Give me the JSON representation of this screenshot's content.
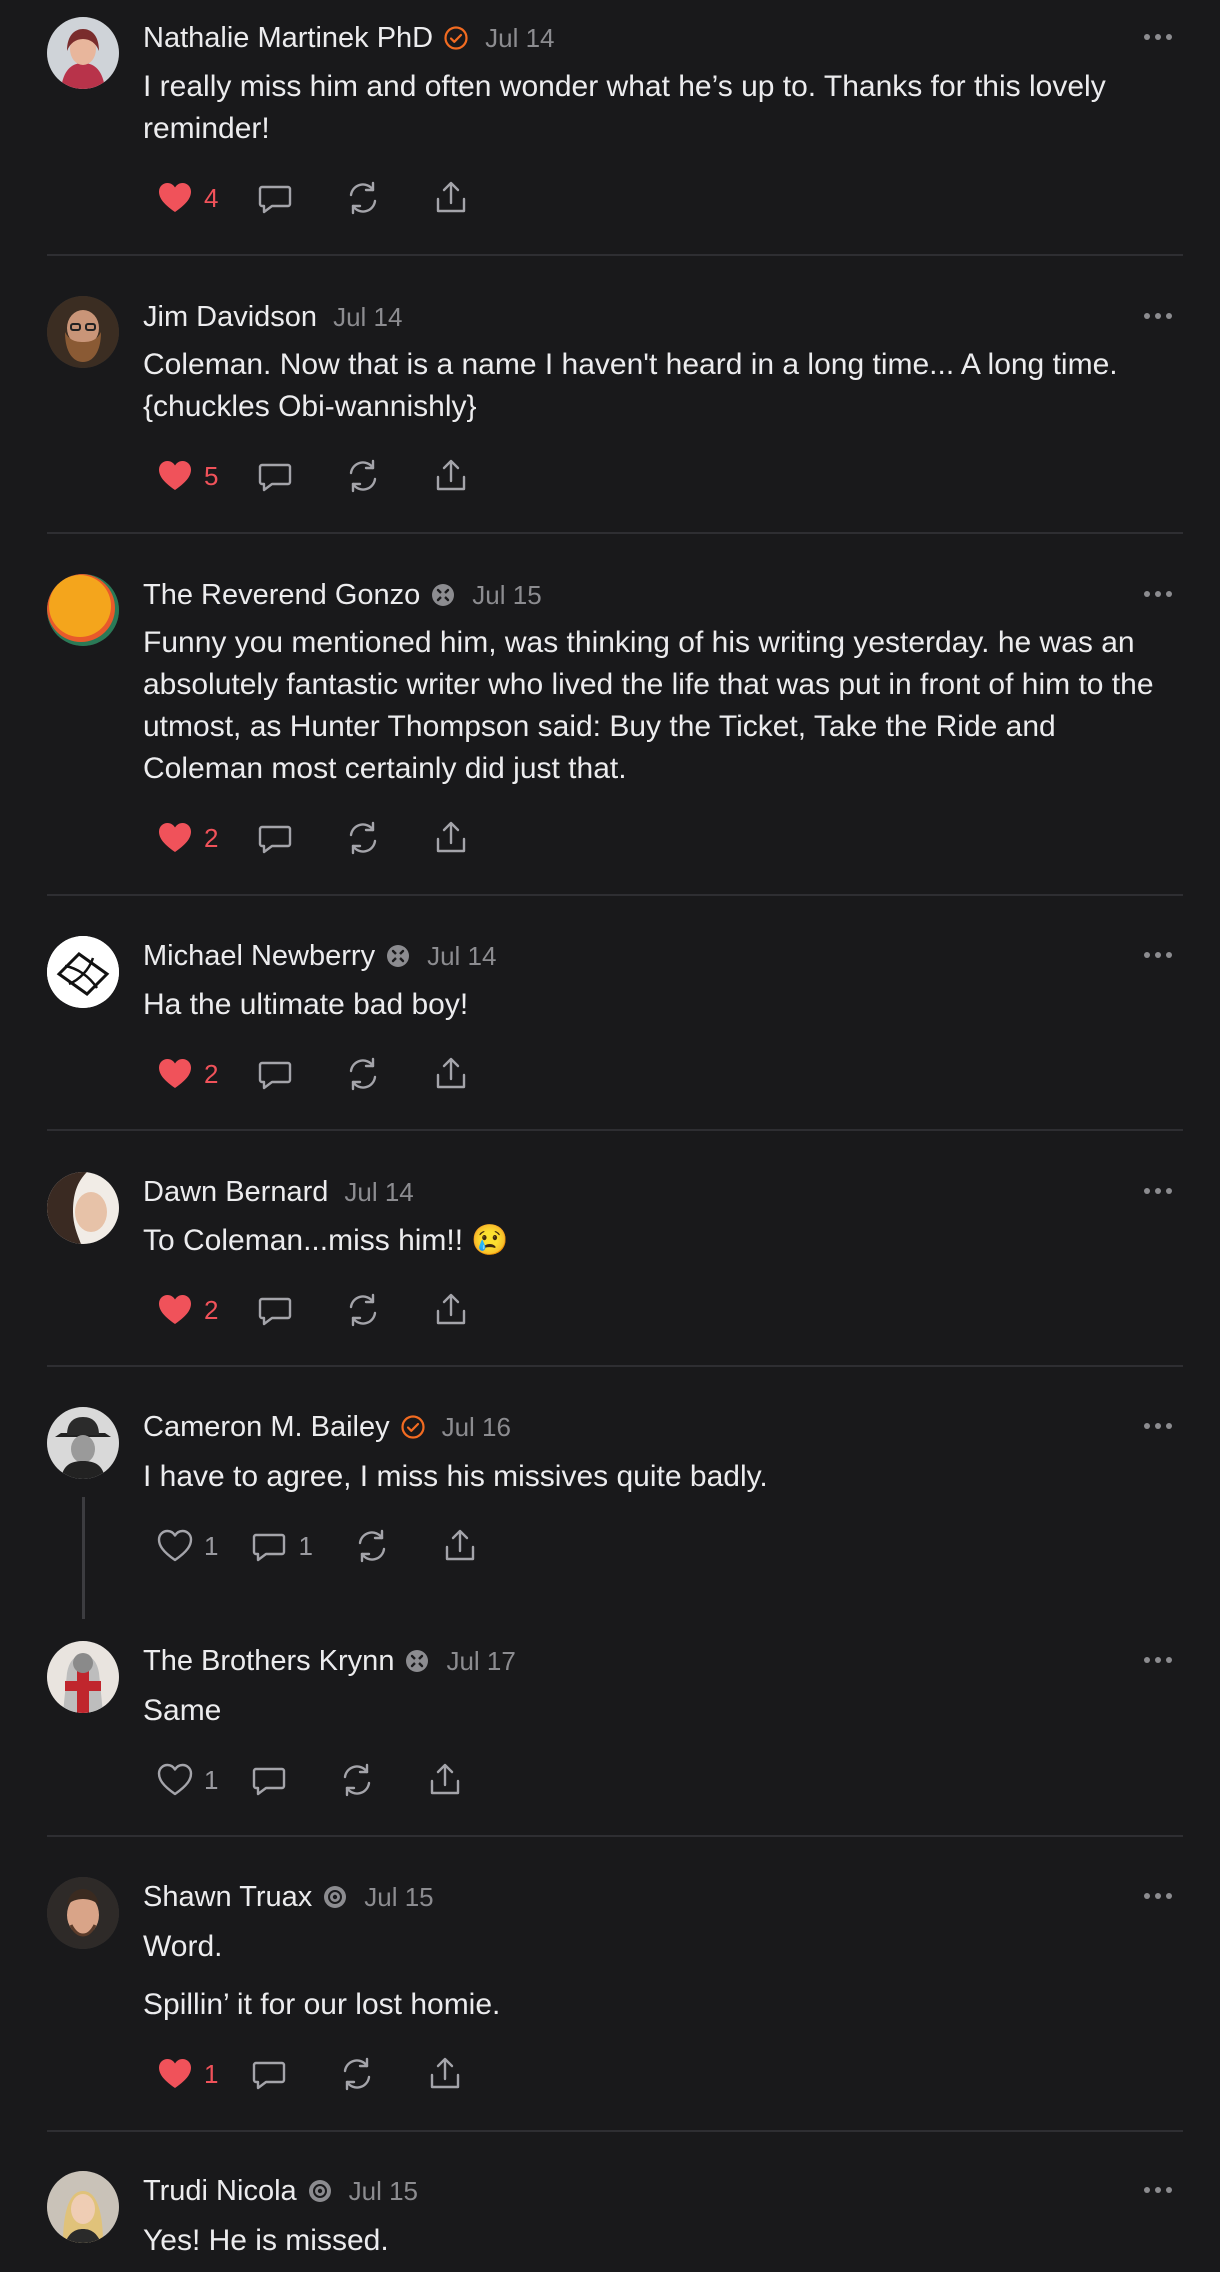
{
  "colors": {
    "background": "#19191b",
    "like": "#f0525a",
    "verified": "#f26b21",
    "muted": "#8c8c90"
  },
  "comments": [
    {
      "name": "Nathalie Martinek PhD",
      "badge": "verified-check-icon",
      "date": "Jul 14",
      "body": [
        "I really miss him and often wonder what he’s up to. Thanks for this lovely reminder!"
      ],
      "likes": "4",
      "liked": true,
      "replies": ""
    },
    {
      "name": "Jim Davidson",
      "badge": "",
      "date": "Jul 14",
      "body": [
        "Coleman. Now that is a name I haven't heard in a long time... A long time. {chuckles Obi-wannishly}"
      ],
      "likes": "5",
      "liked": true,
      "replies": ""
    },
    {
      "name": "The Reverend Gonzo",
      "badge": "subscriber-icon",
      "date": "Jul 15",
      "body": [
        "Funny you mentioned him, was thinking of his writing yesterday. he was an absolutely fantastic writer who lived the life that was put in front of him to the utmost, as Hunter Thompson said: Buy the Ticket, Take the Ride and Coleman most certainly did just that."
      ],
      "likes": "2",
      "liked": true,
      "replies": ""
    },
    {
      "name": "Michael Newberry",
      "badge": "subscriber-icon",
      "date": "Jul 14",
      "body": [
        "Ha the ultimate bad boy!"
      ],
      "likes": "2",
      "liked": true,
      "replies": ""
    },
    {
      "name": "Dawn Bernard",
      "badge": "",
      "date": "Jul 14",
      "body": [
        "To Coleman...miss him!! 😢"
      ],
      "likes": "2",
      "liked": true,
      "replies": ""
    },
    {
      "name": "Cameron M. Bailey",
      "badge": "verified-check-icon",
      "date": "Jul 16",
      "body": [
        "I have to agree, I miss his missives quite badly."
      ],
      "likes": "1",
      "liked": false,
      "replies": "1"
    },
    {
      "name": "The Brothers Krynn",
      "badge": "subscriber-icon",
      "date": "Jul 17",
      "body": [
        "Same"
      ],
      "likes": "1",
      "liked": false,
      "replies": ""
    },
    {
      "name": "Shawn Truax",
      "badge": "subscriber-icon",
      "date": "Jul 15",
      "body": [
        "Word.",
        "Spillin’ it for our lost homie."
      ],
      "likes": "1",
      "liked": true,
      "replies": ""
    },
    {
      "name": "Trudi Nicola",
      "badge": "subscriber-icon",
      "date": "Jul 15",
      "body": [
        "Yes! He is missed."
      ],
      "likes": "",
      "liked": false,
      "replies": ""
    }
  ]
}
